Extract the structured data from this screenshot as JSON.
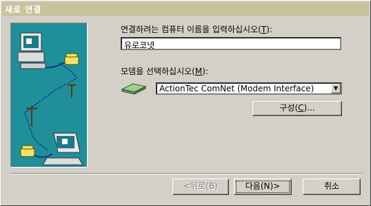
{
  "window": {
    "title": "새로 연결"
  },
  "form": {
    "name_label_prefix": "연결하려는 컴퓨터 이름을 입력하십시오(",
    "name_label_key": "T",
    "name_label_suffix": "):",
    "name_value": "유로코넷",
    "modem_label_prefix": "모뎀을 선택하십시오(",
    "modem_label_key": "M",
    "modem_label_suffix": "):",
    "modem_selected": "ActionTec ComNet (Modem Interface)",
    "configure_prefix": "구성(",
    "configure_key": "C",
    "configure_suffix": ")..."
  },
  "buttons": {
    "back": "<뒤로(B)",
    "next": "다음(N)>",
    "cancel": "취소"
  }
}
